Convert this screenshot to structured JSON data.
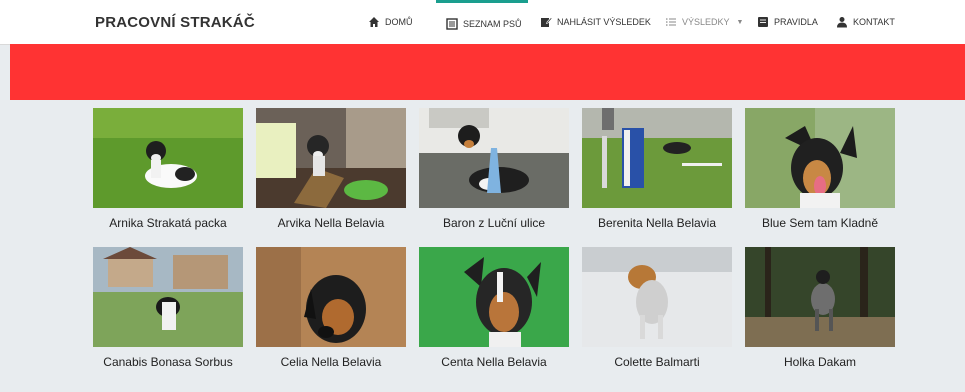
{
  "brand": "PRACOVNÍ STRAKÁČ",
  "nav": {
    "home": "DOMŮ",
    "dogs": "SEZNAM PSŮ",
    "report": "NAHLÁSIT VÝSLEDEK",
    "results": "VÝSLEDKY",
    "rules": "PRAVIDLA",
    "contact": "KONTAKT"
  },
  "colors": {
    "banner": "#ff3333",
    "accent": "#1a9e8e",
    "background": "#e8ecef"
  },
  "dogs": [
    {
      "name": "Arnika Strakatá packa"
    },
    {
      "name": "Arvika Nella Belavia"
    },
    {
      "name": "Baron z Luční ulice"
    },
    {
      "name": "Berenita Nella Belavia"
    },
    {
      "name": "Blue Sem tam Kladně"
    },
    {
      "name": "Canabis Bonasa Sorbus"
    },
    {
      "name": "Celia Nella Belavia"
    },
    {
      "name": "Centa Nella Belavia"
    },
    {
      "name": "Colette Balmarti"
    },
    {
      "name": "Holka Dakam"
    }
  ]
}
